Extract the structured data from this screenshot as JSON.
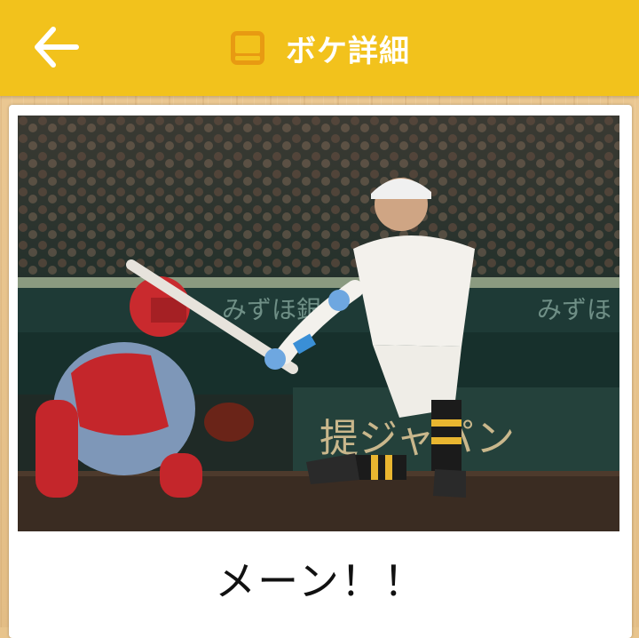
{
  "header": {
    "title": "ボケ詳細",
    "back_icon": "arrow-left-icon",
    "title_icon": "tablet-icon",
    "background": "#f2c21c"
  },
  "post": {
    "image_description": "baseball-batter-photo",
    "caption": "メーン！！"
  }
}
